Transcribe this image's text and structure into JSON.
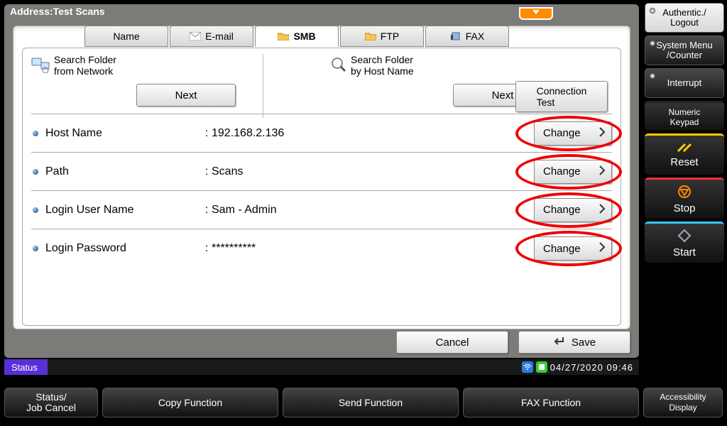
{
  "title": "Address:Test Scans",
  "tabs": [
    "Name",
    "E-mail",
    "SMB",
    "FTP",
    "FAX"
  ],
  "active_tab": 2,
  "search_network_label": "Search Folder\nfrom Network",
  "search_host_label": "Search Folder\nby Host Name",
  "next_label": "Next",
  "conn_test_label": "Connection\nTest",
  "rows": [
    {
      "label": "Host Name",
      "value": "192.168.2.136"
    },
    {
      "label": "Path",
      "value": "Scans"
    },
    {
      "label": "Login User Name",
      "value": "Sam - Admin"
    },
    {
      "label": "Login Password",
      "value": "**********"
    }
  ],
  "change_label": "Change",
  "cancel_label": "Cancel",
  "save_label": "Save",
  "side": {
    "auth": "Authentic./\nLogout",
    "sysmenu": "System Menu\n/Counter",
    "interrupt": "Interrupt",
    "keypad": "Numeric\nKeypad",
    "reset": "Reset",
    "stop": "Stop",
    "start": "Start"
  },
  "status_label": "Status",
  "datetime": "04/27/2020  09:46",
  "bottom": {
    "status": "Status/\nJob Cancel",
    "copy": "Copy Function",
    "send": "Send Function",
    "fax": "FAX Function",
    "access": "Accessibility\nDisplay"
  }
}
